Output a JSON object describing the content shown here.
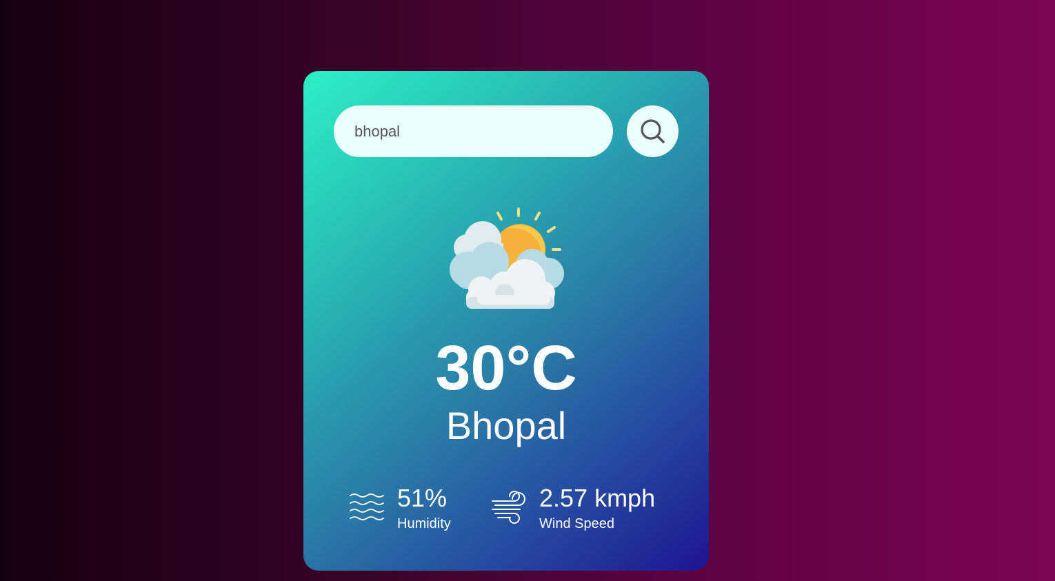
{
  "search": {
    "value": "bhopal",
    "placeholder": "",
    "button_icon": "search-icon"
  },
  "weather": {
    "condition_icon": "partly-cloudy-icon",
    "temperature": "30°C",
    "city": "Bhopal"
  },
  "details": {
    "humidity": {
      "icon": "humidity-icon",
      "value": "51%",
      "label": "Humidity"
    },
    "wind": {
      "icon": "wind-icon",
      "value": "2.57 kmph",
      "label": "Wind Speed"
    }
  },
  "colors": {
    "background_left": "#150010",
    "background_right": "#7a0555",
    "card_top_left": "#2cf0c4",
    "card_bottom_right": "#1e1591",
    "input_background": "#ebfffb",
    "text": "#ffffff"
  }
}
